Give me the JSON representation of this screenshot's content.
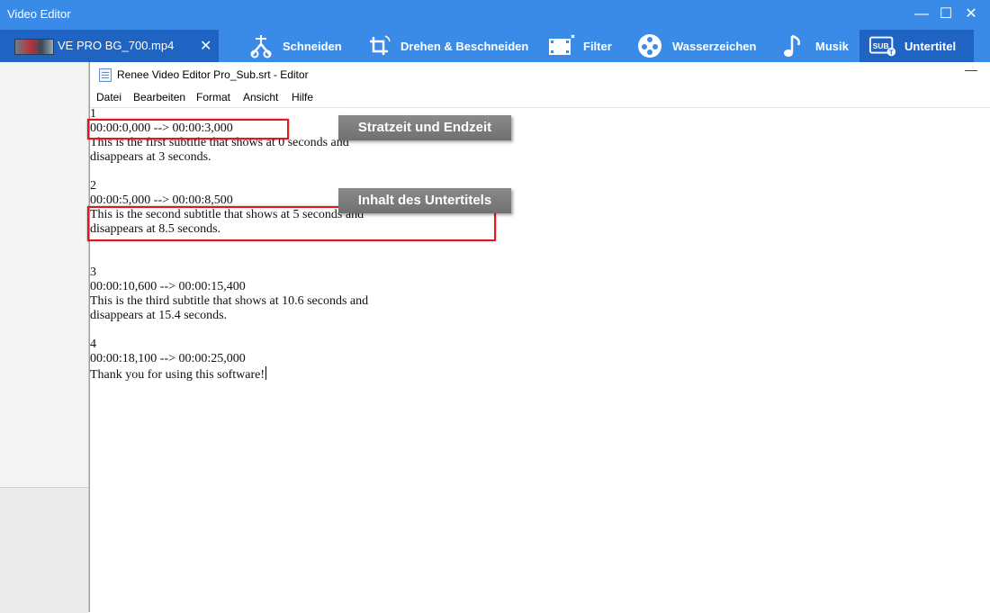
{
  "app": {
    "title": "Video Editor"
  },
  "window_controls": {
    "minimize": "—",
    "maximize": "☐",
    "close": "✕"
  },
  "file_tab": {
    "name": "VE PRO BG_700.mp4",
    "close": "✕"
  },
  "tools": [
    {
      "label": "Schneiden",
      "icon": "cut-icon"
    },
    {
      "label": "Drehen & Beschneiden",
      "icon": "rotate-crop-icon"
    },
    {
      "label": "Filter",
      "icon": "filter-icon"
    },
    {
      "label": "Wasserzeichen",
      "icon": "watermark-icon"
    },
    {
      "label": "Musik",
      "icon": "music-note-icon"
    },
    {
      "label": "Untertitel",
      "icon": "subtitle-icon",
      "active": true
    }
  ],
  "notepad": {
    "title": "Renee Video Editor Pro_Sub.srt - Editor",
    "minimize": "—",
    "menu": [
      "Datei",
      "Bearbeiten",
      "Format",
      "Ansicht",
      "Hilfe"
    ]
  },
  "content": {
    "lines": [
      "1",
      "00:00:0,000 --> 00:00:3,000",
      "This is the first subtitle that shows at 0 seconds and",
      "disappears at 3 seconds.",
      "",
      "2",
      "00:00:5,000 --> 00:00:8,500",
      "This is the second subtitle that shows at 5 seconds and",
      "disappears at 8.5 seconds.",
      "",
      "",
      "3",
      "00:00:10,600 --> 00:00:15,400",
      "This is the third subtitle that shows at 10.6 seconds and",
      "disappears at 15.4 seconds.",
      "",
      "4",
      "00:00:18,100 --> 00:00:25,000",
      "Thank you for using this software!"
    ]
  },
  "annotations": {
    "time_label": "Stratzeit und Endzeit",
    "content_label": "Inhalt des Untertitels",
    "highlight_color": "#e8161c"
  },
  "colors": {
    "title_bar": "#3a8be8",
    "active_tab": "#1f64c2"
  }
}
